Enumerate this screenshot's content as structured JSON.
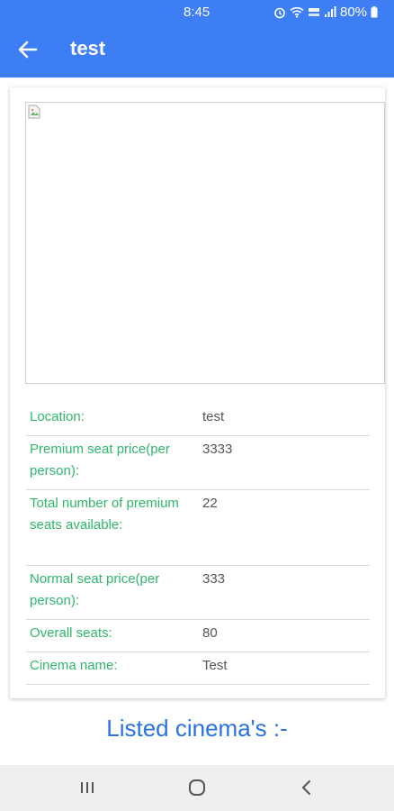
{
  "status_bar": {
    "time": "8:45",
    "battery": "80%"
  },
  "toolbar": {
    "title": "test",
    "back_icon": "arrow-left-icon"
  },
  "details": [
    {
      "label": "Location:",
      "value": "test"
    },
    {
      "label": "Premium seat price(per person):",
      "value": "3333"
    },
    {
      "label": "Total number of premium seats available:",
      "value": "22"
    },
    {
      "label": "Normal seat price(per person):",
      "value": "333"
    },
    {
      "label": "Overall seats:",
      "value": "80"
    },
    {
      "label": "Cinema name:",
      "value": "Test"
    }
  ],
  "listed_heading": "Listed cinema's :-",
  "colors": {
    "app_bar": "#3d7ef5",
    "label_green": "#2fb86a",
    "heading_blue": "#2a72e3"
  }
}
